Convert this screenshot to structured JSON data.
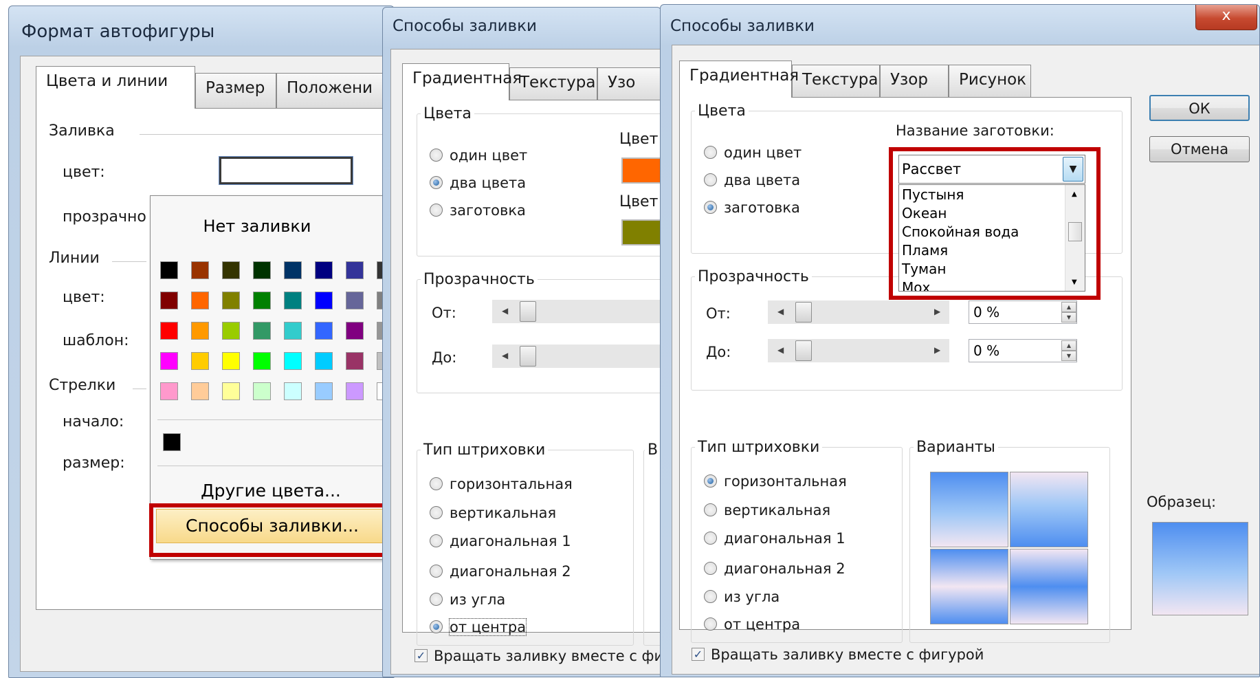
{
  "dialog1": {
    "title": "Формат автофигуры",
    "tabs": [
      "Цвета и линии",
      "Размер",
      "Положени"
    ],
    "fill_section": "Заливка",
    "color_label": "цвет:",
    "transparency_label": "прозрачно",
    "lines_section": "Линии",
    "line_color_label": "цвет:",
    "pattern_label": "шаблон:",
    "arrows_section": "Стрелки",
    "start_label": "начало:",
    "size_label": "размер:"
  },
  "color_popup": {
    "no_fill": "Нет заливки",
    "other_colors": "Другие цвета...",
    "fill_effects": "Способы заливки...",
    "swatch_rows": [
      [
        "#000000",
        "#993300",
        "#333300",
        "#003300",
        "#003366",
        "#000080",
        "#333399",
        "#333333"
      ],
      [
        "#800000",
        "#ff6600",
        "#808000",
        "#008000",
        "#008080",
        "#0000ff",
        "#666699",
        "#808080"
      ],
      [
        "#ff0000",
        "#ff9900",
        "#99cc00",
        "#339966",
        "#33cccc",
        "#3366ff",
        "#800080",
        "#969696"
      ],
      [
        "#ff00ff",
        "#ffcc00",
        "#ffff00",
        "#00ff00",
        "#00ffff",
        "#00ccff",
        "#993366",
        "#c0c0c0"
      ],
      [
        "#ff99cc",
        "#ffcc99",
        "#ffff99",
        "#ccffcc",
        "#ccffff",
        "#99ccff",
        "#cc99ff",
        "#ffffff"
      ]
    ],
    "recent_color": "#000000"
  },
  "dialog2": {
    "title": "Способы заливки",
    "tabs": [
      "Градиентная",
      "Текстура",
      "Узо"
    ],
    "colors_group": "Цвета",
    "radio_one": "один цвет",
    "radio_two": "два цвета",
    "radio_preset": "заготовка",
    "color1_label": "Цвет",
    "color2_label": "Цвет",
    "color1": "#ff6600",
    "color2": "#808000",
    "transparency_group": "Прозрачность",
    "from_label": "От:",
    "to_label": "До:",
    "shading_group": "Тип штриховки",
    "variants_cut": "В",
    "shading": [
      "горизонтальная",
      "вертикальная",
      "диагональная 1",
      "диагональная 2",
      "из угла",
      "от центра"
    ],
    "rotate_label": "Вращать заливку вместе с фигу"
  },
  "dialog3": {
    "title": "Способы заливки",
    "close": "x",
    "tabs": [
      "Градиентная",
      "Текстура",
      "Узор",
      "Рисунок"
    ],
    "colors_group": "Цвета",
    "radio_one": "один цвет",
    "radio_two": "два цвета",
    "radio_preset": "заготовка",
    "preset_label": "Название заготовки:",
    "preset_value": "Рассвет",
    "preset_options": [
      "Пустыня",
      "Океан",
      "Спокойная вода",
      "Пламя",
      "Туман",
      "Мох"
    ],
    "transparency_group": "Прозрачность",
    "from_label": "От:",
    "to_label": "До:",
    "from_value": "0 %",
    "to_value": "0 %",
    "shading_group": "Тип штриховки",
    "shading": [
      "горизонтальная",
      "вертикальная",
      "диагональная 1",
      "диагональная 2",
      "из угла",
      "от центра"
    ],
    "variants_group": "Варианты",
    "sample_label": "Образец:",
    "ok": "ОК",
    "cancel": "Отмена",
    "rotate_label": "Вращать заливку вместе с фигурой"
  }
}
